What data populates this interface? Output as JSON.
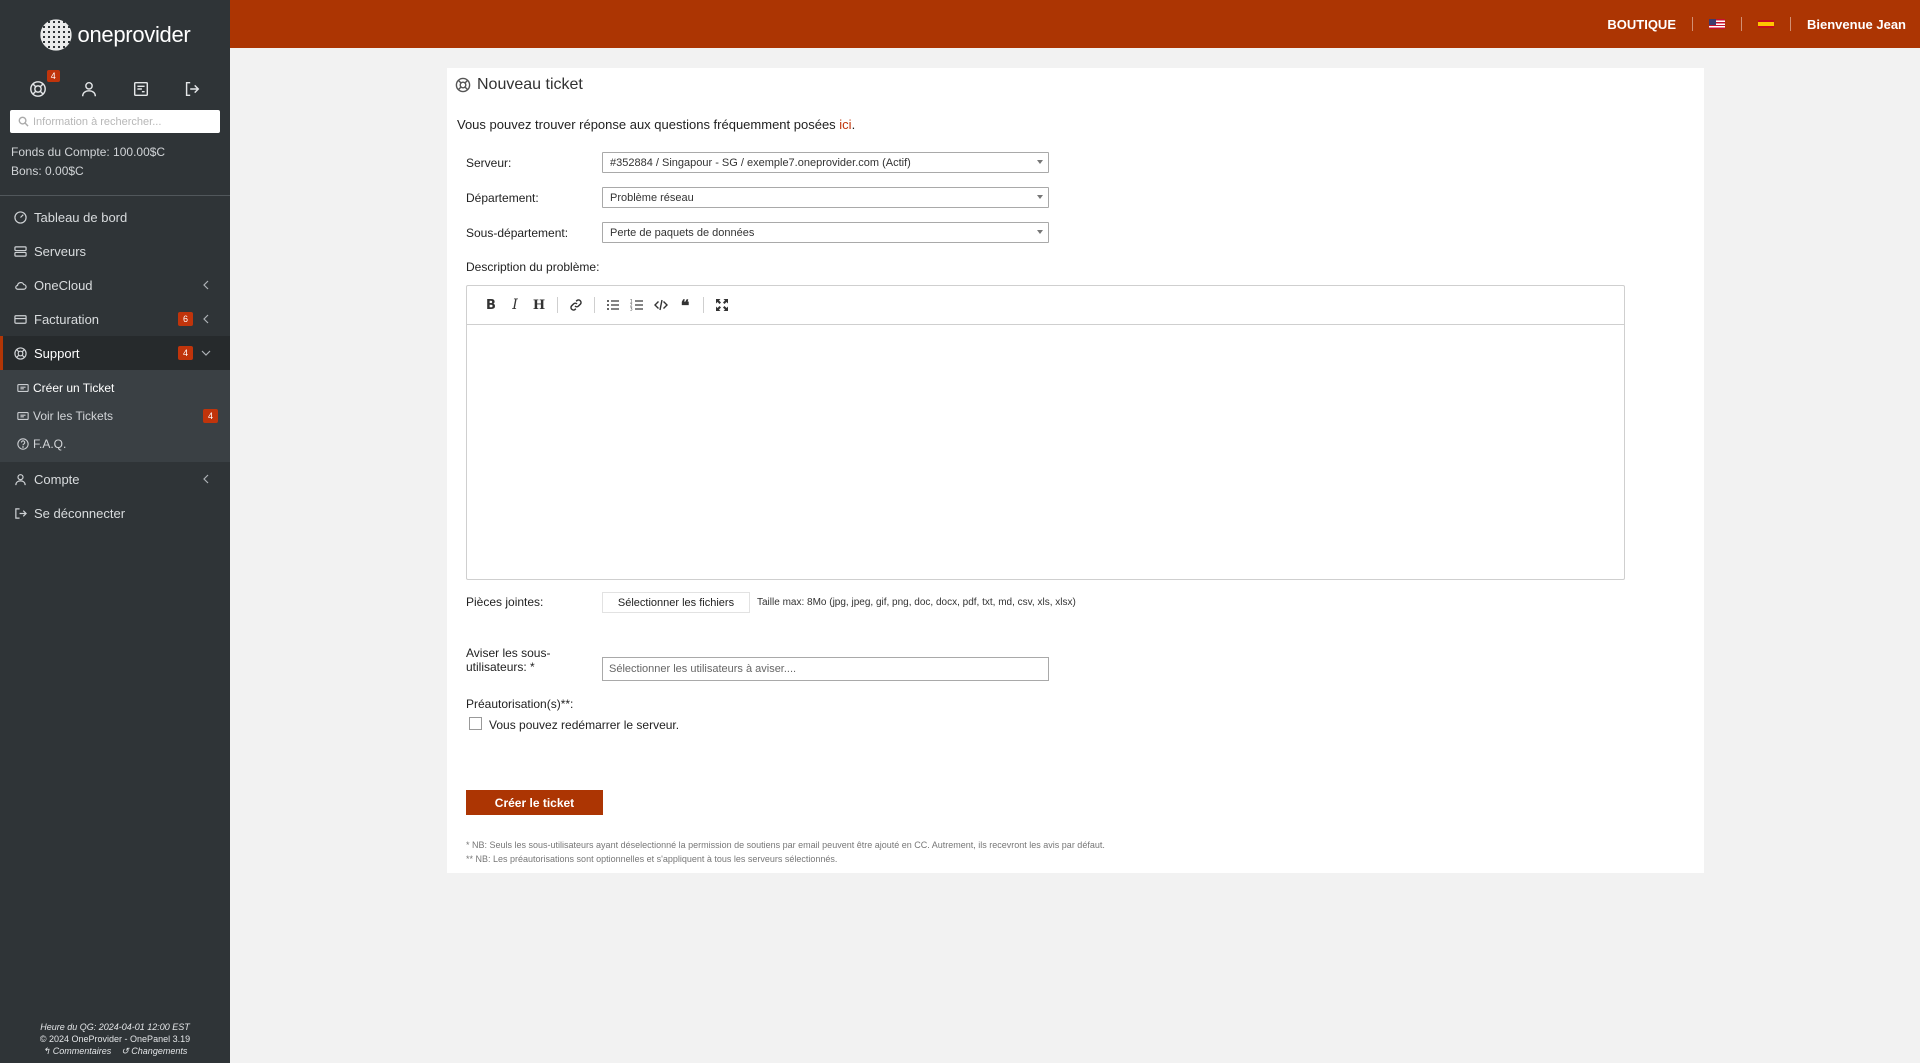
{
  "brand": {
    "name": "oneprovider"
  },
  "quick_icons": {
    "support_badge": "4"
  },
  "search": {
    "placeholder": "Information à rechercher..."
  },
  "account": {
    "funds": "Fonds du Compte: 100.00$C",
    "vouchers": "Bons: 0.00$C"
  },
  "nav": {
    "dashboard": "Tableau de bord",
    "servers": "Serveurs",
    "onecloud": "OneCloud",
    "billing": "Facturation",
    "billing_count": "6",
    "support": "Support",
    "support_count": "4",
    "support_sub": {
      "create": "Créer un Ticket",
      "view": "Voir les Tickets",
      "view_count": "4",
      "faq": "F.A.Q."
    },
    "account": "Compte",
    "logout": "Se déconnecter"
  },
  "footer": {
    "hq_time": "Heure du QG: 2024-04-01 12:00 EST",
    "copyright": "© 2024 OneProvider  -  OnePanel 3.19",
    "comments": "Commentaires",
    "changes": "Changements"
  },
  "topbar": {
    "shop": "BOUTIQUE",
    "welcome": "Bienvenue Jean"
  },
  "ticket": {
    "title": "Nouveau ticket",
    "faq_text": "Vous pouvez trouver réponse aux questions fréquemment posées ",
    "faq_link": "ici",
    "faq_end": ".",
    "server_label": "Serveur:",
    "server_value": "#352884 / Singapour - SG / exemple7.oneprovider.com (Actif)",
    "department_label": "Département:",
    "department_value": "Problème réseau",
    "subdepartment_label": "Sous-département:",
    "subdepartment_value": "Perte de paquets de données",
    "description_label": "Description du problème:",
    "attachments_label": "Pièces jointes:",
    "attachments_button": "Sélectionner les fichiers",
    "attachments_hint": "Taille max: 8Mo (jpg, jpeg, gif, png, doc, docx, pdf, txt, md, csv, xls, xlsx)",
    "notify_label_1": "Aviser les sous-",
    "notify_label_2": "utilisateurs: *",
    "notify_placeholder": "Sélectionner les utilisateurs à aviser....",
    "preauth_label": "Préautorisation(s)**:",
    "preauth_option": "Vous pouvez redémarrer le serveur.",
    "submit": "Créer le ticket",
    "note1": "* NB: Seuls les sous-utilisateurs ayant déselectionné la permission de soutiens par email peuvent être ajouté en CC. Autrement, ils recevront les avis par défaut.",
    "note2": "** NB: Les préautorisations sont optionnelles et s'appliquent à tous les serveurs sélectionnés."
  }
}
